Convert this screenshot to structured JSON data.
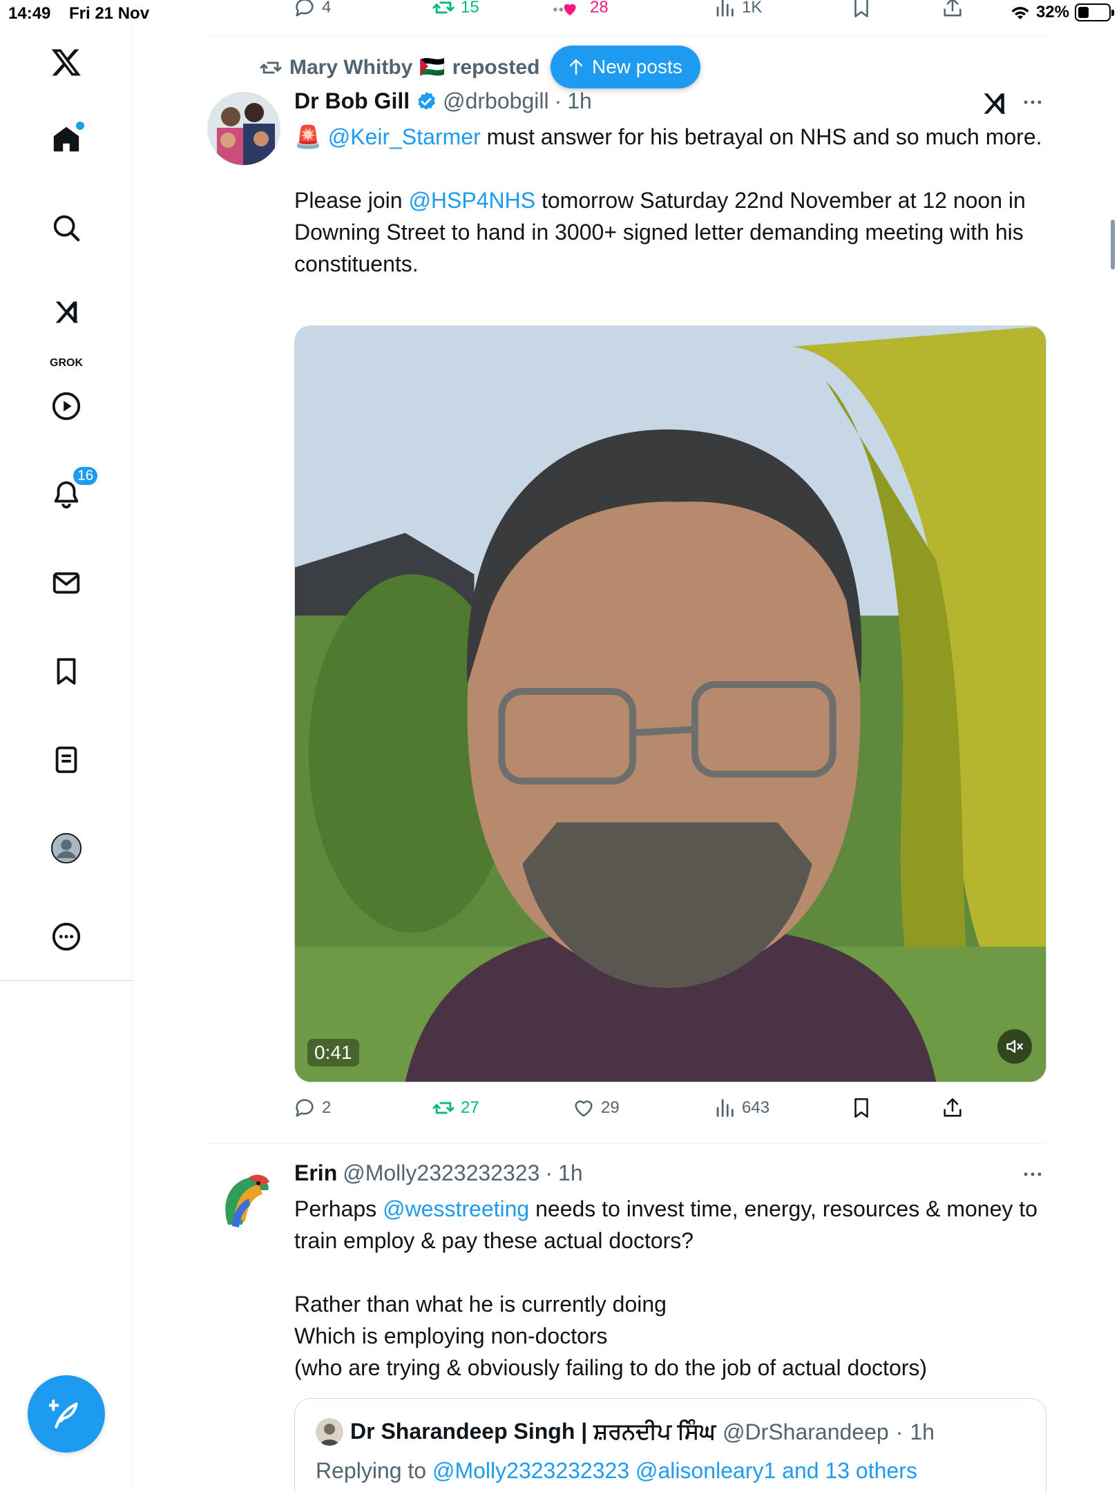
{
  "status_bar": {
    "time": "14:49",
    "date": "Fri 21 Nov",
    "battery": "32%",
    "battery_level": 0.32
  },
  "sidebar": {
    "grok_label": "GROK",
    "notification_count": "16"
  },
  "prev_post_actions": {
    "replies": "4",
    "reposts": "15",
    "likes": "28",
    "views": "1K"
  },
  "new_posts_label": "New posts",
  "post": {
    "repost_user": "Mary Whitby",
    "repost_flag": "🇵🇸",
    "repost_label": "reposted",
    "name": "Dr Bob Gill",
    "handle": "@drbobgill",
    "time": "1h",
    "line1_emoji": "🚨",
    "line1_mention": "@Keir_Starmer",
    "line1_text": " must answer for his betrayal on NHS and so much more.",
    "line2_prefix": "Please join ",
    "line2_mention": "@HSP4NHS",
    "line2_text": " tomorrow Saturday 22nd November at 12 noon in Downing Street to hand in 3000+ signed letter demanding meeting with his constituents.",
    "video_duration": "0:41",
    "replies": "2",
    "reposts": "27",
    "likes": "29",
    "views": "643"
  },
  "reply": {
    "name": "Erin",
    "handle": "@Molly2323232323",
    "time": "1h",
    "p1_prefix": "Perhaps ",
    "p1_mention": "@wesstreeting",
    "p1_text": " needs to invest time, energy, resources & money to train employ & pay these actual doctors?",
    "p2_line1": "Rather than what he is currently doing",
    "p2_line2": "Which is employing non-doctors",
    "p2_line3": "(who are trying & obviously failing to do the job of actual doctors)",
    "quote": {
      "name": "Dr Sharandeep Singh | ਸ਼ਰਨਦੀਪ ਸਿੰਘ",
      "handle": "@DrSharandeep",
      "time": "1h",
      "replying_label": "Replying to ",
      "replying_targets": "@Molly2323232323 @alisonleary1 and 13 others"
    }
  },
  "colors": {
    "accent": "#1d9bf0",
    "repost_green": "#00ba7c",
    "like_pink": "#f91880",
    "secondary_text": "#536471"
  }
}
